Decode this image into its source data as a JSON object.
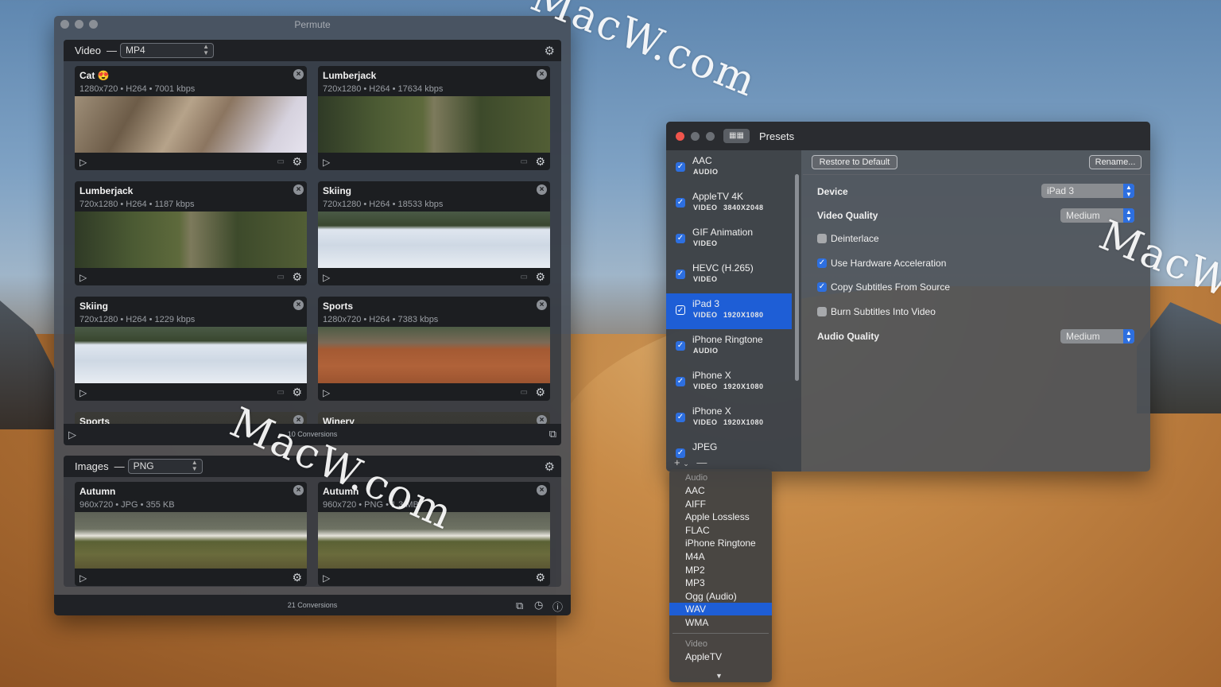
{
  "watermarks": [
    "MacW.com",
    "MacW.com",
    "MacW.com"
  ],
  "permute": {
    "title": "Permute",
    "video": {
      "label": "Video",
      "format": "MP4",
      "items": [
        {
          "name": "Cat 😍",
          "meta": "1280x720 • H264 • 7001 kbps"
        },
        {
          "name": "Lumberjack",
          "meta": "720x1280 • H264 • 17634 kbps"
        },
        {
          "name": "Lumberjack",
          "meta": "720x1280 • H264 • 1187 kbps"
        },
        {
          "name": "Skiing",
          "meta": "720x1280 • H264 • 18533 kbps"
        },
        {
          "name": "Skiing",
          "meta": "720x1280 • H264 • 1229 kbps"
        },
        {
          "name": "Sports",
          "meta": "1280x720 • H264 • 7383 kbps"
        },
        {
          "name": "Sports",
          "meta": ""
        },
        {
          "name": "Winery",
          "meta": ""
        }
      ],
      "conversions": "10 Conversions"
    },
    "images": {
      "label": "Images",
      "format": "PNG",
      "items": [
        {
          "name": "Autumn",
          "meta": "960x720 • JPG • 355 KB"
        },
        {
          "name": "Autumn",
          "meta": "960x720 • PNG • 1.3 MB"
        }
      ]
    },
    "total_conversions": "21 Conversions"
  },
  "presets": {
    "title": "Presets",
    "list": [
      {
        "name": "AAC",
        "type": "AUDIO",
        "res": ""
      },
      {
        "name": "AppleTV 4K",
        "type": "VIDEO",
        "res": "3840X2048"
      },
      {
        "name": "GIF Animation",
        "type": "VIDEO",
        "res": ""
      },
      {
        "name": "HEVC (H.265)",
        "type": "VIDEO",
        "res": ""
      },
      {
        "name": "iPad 3",
        "type": "VIDEO",
        "res": "1920X1080"
      },
      {
        "name": "iPhone Ringtone",
        "type": "AUDIO",
        "res": ""
      },
      {
        "name": "iPhone X",
        "type": "VIDEO",
        "res": "1920X1080"
      },
      {
        "name": "iPhone X",
        "type": "VIDEO",
        "res": "1920X1080"
      },
      {
        "name": "JPEG",
        "type": "",
        "res": ""
      }
    ],
    "restore_label": "Restore to Default",
    "rename_label": "Rename...",
    "device_label": "Device",
    "device_value": "iPad 3",
    "video_quality_label": "Video Quality",
    "video_quality_value": "Medium",
    "deinterlace_label": "Deinterlace",
    "hw_accel_label": "Use Hardware Acceleration",
    "copy_subs_label": "Copy Subtitles From Source",
    "burn_subs_label": "Burn Subtitles Into Video",
    "audio_quality_label": "Audio Quality",
    "audio_quality_value": "Medium",
    "add_symbol": "+",
    "remove_symbol": "—"
  },
  "menu": {
    "audio_header": "Audio",
    "audio_items": [
      "AAC",
      "AIFF",
      "Apple Lossless",
      "FLAC",
      "iPhone Ringtone",
      "M4A",
      "MP2",
      "MP3",
      "Ogg (Audio)",
      "WAV",
      "WMA"
    ],
    "video_header": "Video",
    "video_items": [
      "AppleTV"
    ]
  }
}
